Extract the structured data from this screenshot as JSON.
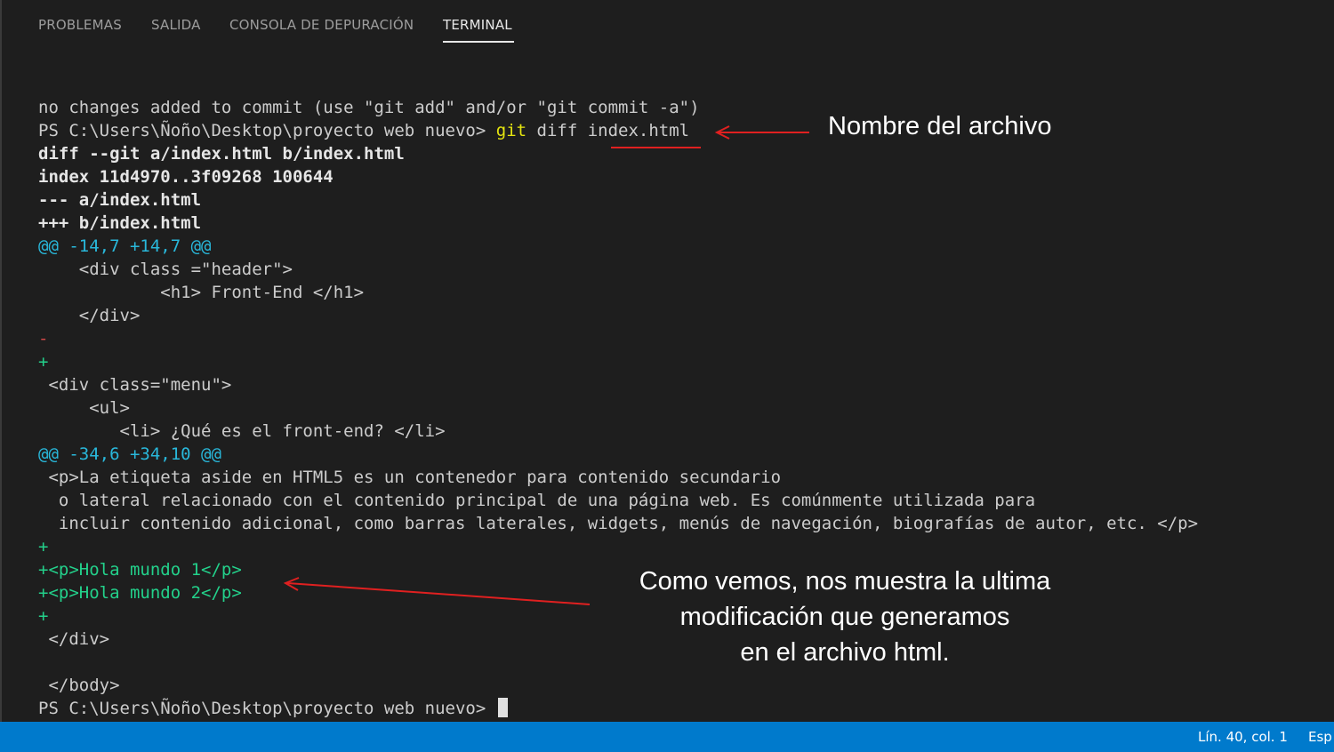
{
  "panel": {
    "tabs": [
      {
        "label": "PROBLEMAS"
      },
      {
        "label": "SALIDA"
      },
      {
        "label": "CONSOLA DE DEPURACIÓN"
      },
      {
        "label": "TERMINAL"
      }
    ],
    "active_tab": "TERMINAL"
  },
  "terminal": {
    "no_changes": "no changes added to commit (use \"git add\" and/or \"git commit -a\")",
    "prompt": "PS C:\\Users\\Ñoño\\Desktop\\proyecto web nuevo> ",
    "cmd_git": "git",
    "cmd_rest": " diff index.html",
    "diff_header": "diff --git a/index.html b/index.html",
    "index_line": "index 11d4970..3f09268 100644",
    "minus_file": "--- a/index.html",
    "plus_file": "+++ b/index.html",
    "hunk1": "@@ -14,7 +14,7 @@",
    "line_div_header": "    <div class =\"header\">",
    "line_h1": "            <h1> Front-End </h1>",
    "line_div_close1": "    </div>",
    "line_minus": "-",
    "line_plus1": "+",
    "line_div_menu": " <div class=\"menu\">",
    "line_ul": "     <ul>",
    "line_li": "        <li> ¿Qué es el front-end? </li>",
    "hunk2": "@@ -34,6 +34,10 @@",
    "line_p1": " <p>La etiqueta aside en HTML5 es un contenedor para contenido secundario",
    "line_p2": "  o lateral relacionado con el contenido principal de una página web. Es comúnmente utilizada para",
    "line_p3": "  incluir contenido adicional, como barras laterales, widgets, menús de navegación, biografías de autor, etc. </p>",
    "line_plus2": "+",
    "line_hola1": "+<p>Hola mundo 1</p>",
    "line_hola2": "+<p>Hola mundo 2</p>",
    "line_plus3": "+",
    "line_div_close2": " </div>",
    "line_blank": "",
    "line_body": " </body>",
    "final_prompt": "PS C:\\Users\\Ñoño\\Desktop\\proyecto web nuevo> "
  },
  "annotations": {
    "file_name_note": "Nombre del archivo",
    "modification_note": [
      "Como vemos, nos muestra la ultima",
      "modificación que generamos",
      "en el archivo html."
    ],
    "arrow_color": "#e02020"
  },
  "statusbar": {
    "position": "Lín. 40, col. 1",
    "language": "Esp"
  },
  "colors": {
    "background": "#1e1e1e",
    "status_bar": "#007acc",
    "hunk": "#29b8db",
    "removed": "#d14848",
    "added": "#23d18b",
    "command": "#e5e510"
  }
}
